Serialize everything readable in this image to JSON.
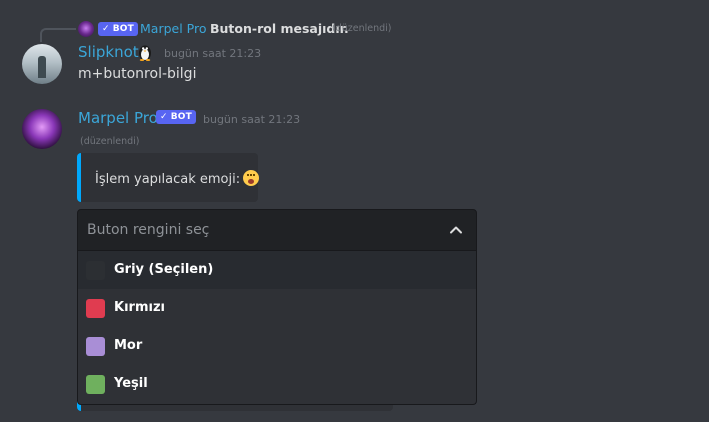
{
  "reply": {
    "author": "Marpel Pro",
    "bot_tag": "BOT",
    "text": "Buton-rol mesajıdır.",
    "edited": "(düzenlendi)"
  },
  "messages": [
    {
      "author": "Slipknot",
      "timestamp": "bugün saat 21:23",
      "content": "m+butonrol-bilgi"
    },
    {
      "author": "Marpel Pro",
      "bot_tag": "BOT",
      "timestamp": "bugün saat 21:23",
      "edited": "(düzenlendi)",
      "embed_text": "İşlem yapılacak emoji:"
    }
  ],
  "select_menu": {
    "placeholder": "Buton rengini seç",
    "options": [
      {
        "label": "Griy (Seçilen)",
        "color": "#2c2f33",
        "selected": true
      },
      {
        "label": "Kırmızı",
        "color": "#e03c50",
        "selected": false
      },
      {
        "label": "Mor",
        "color": "#a98ed6",
        "selected": false
      },
      {
        "label": "Yeşil",
        "color": "#6fb05e",
        "selected": false
      }
    ]
  },
  "colors": {
    "background": "#36393f",
    "username": "#3ba6d8",
    "bot_tag": "#5865f2",
    "embed_border": "#00a8fc"
  }
}
